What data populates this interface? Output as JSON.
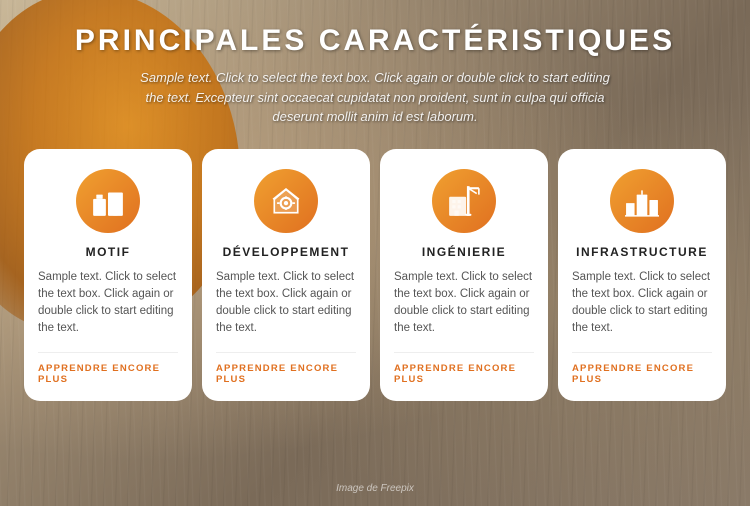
{
  "page": {
    "title": "PRINCIPALES CARACTÉRISTIQUES",
    "subtitle": "Sample text. Click to select the text box. Click again or double click to start editing the text. Excepteur sint occaecat cupidatat non proident, sunt in culpa qui officia deserunt mollit anim id est laborum.",
    "footer_credit": "Image de Freepix"
  },
  "cards": [
    {
      "id": "motif",
      "icon": "building",
      "title": "MOTIF",
      "text": "Sample text. Click to select the text box. Click again or double click to start editing the text.",
      "link": "APPRENDRE ENCORE PLUS"
    },
    {
      "id": "developpement",
      "icon": "gear-building",
      "title": "DÉVELOPPEMENT",
      "text": "Sample text. Click to select the text box. Click again or double click to start editing the text.",
      "link": "APPRENDRE ENCORE PLUS"
    },
    {
      "id": "ingenierie",
      "icon": "crane",
      "title": "INGÉNIERIE",
      "text": "Sample text. Click to select the text box. Click again or double click to start editing the text.",
      "link": "APPRENDRE ENCORE PLUS"
    },
    {
      "id": "infrastructure",
      "icon": "city",
      "title": "INFRASTRUCTURE",
      "text": "Sample text. Click to select the text box. Click again or double click to start editing the text.",
      "link": "APPRENDRE ENCORE PLUS"
    }
  ]
}
